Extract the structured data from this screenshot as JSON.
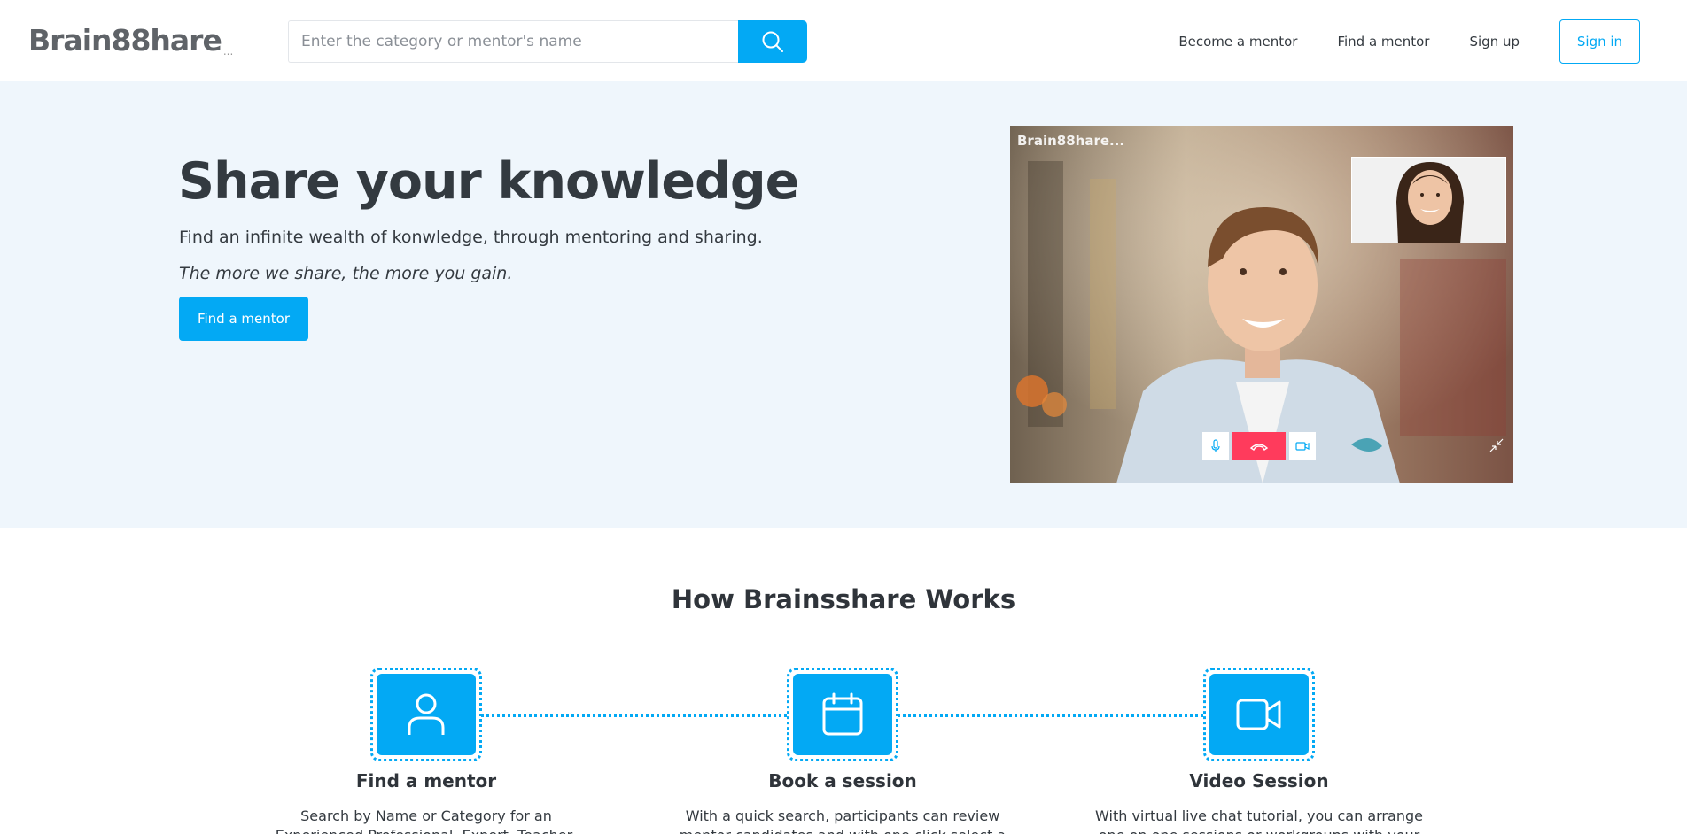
{
  "brand": {
    "logo_text": "Brain88hare",
    "logo_suffix": "...",
    "video_logo": "Brain88hare..."
  },
  "search": {
    "placeholder": "Enter the category or mentor's name",
    "value": ""
  },
  "nav": {
    "become_mentor": "Become a mentor",
    "find_mentor": "Find a mentor",
    "sign_up": "Sign up",
    "sign_in": "Sign in"
  },
  "hero": {
    "title": "Share your knowledge",
    "subtitle": "Find an infinite wealth of konwledge, through mentoring and sharing.",
    "quote": "The more we share, the more you gain.",
    "cta": "Find a mentor"
  },
  "how": {
    "title": "How Brainsshare Works",
    "steps": [
      {
        "title": "Find a mentor",
        "desc": "Search by Name or Category for an Experienced Professional, Expert, Teacher, Performer to meet",
        "icon": "user-icon"
      },
      {
        "title": "Book a session",
        "desc": "With a quick search, participants can review mentor candidates and with one click select a mentor",
        "icon": "calendar-icon"
      },
      {
        "title": "Video Session",
        "desc": "With virtual live chat tutorial, you can arrange one on one sessions or workgroups with your mentor and",
        "icon": "video-camera-icon"
      }
    ]
  },
  "colors": {
    "accent": "#03a9f4",
    "hero_bg": "#eff6fc",
    "end_call": "#ff3b5c"
  }
}
